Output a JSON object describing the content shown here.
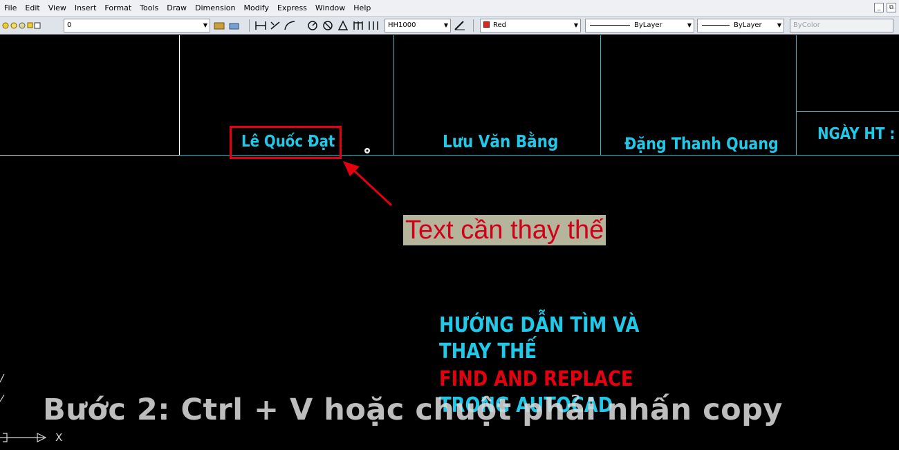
{
  "menubar": {
    "items": [
      "File",
      "Edit",
      "View",
      "Insert",
      "Format",
      "Tools",
      "Draw",
      "Dimension",
      "Modify",
      "Express",
      "Window",
      "Help"
    ],
    "controls": [
      "_",
      "⧉"
    ]
  },
  "toolbar": {
    "layer_value": "0",
    "dimstyle_value": "HH1000",
    "color_value": "Red",
    "color_hex": "#e2231a",
    "linetype_value": "ByLayer",
    "lineweight_value": "ByLayer",
    "plotstyle_value": "ByColor"
  },
  "drawing": {
    "names": [
      "Lê Quốc Đạt",
      "Lưu Văn Bằng",
      "Đặng Thanh Quang"
    ],
    "date_label": "NGÀY HT :",
    "title_lines": [
      "HƯỚNG DẪN TÌM VÀ",
      "THAY THẾ",
      "FIND AND REPLACE",
      "TRONG AUTOCAD"
    ],
    "ucs_x": "X",
    "line_color": "#2fb8c8",
    "text_color": "#22c8e8",
    "accent_red": "#e3000f"
  },
  "annotation": {
    "label": "Text cần thay thế"
  },
  "caption": {
    "text": "Bước 2: Ctrl + V hoặc chuột phải nhấn copy"
  }
}
